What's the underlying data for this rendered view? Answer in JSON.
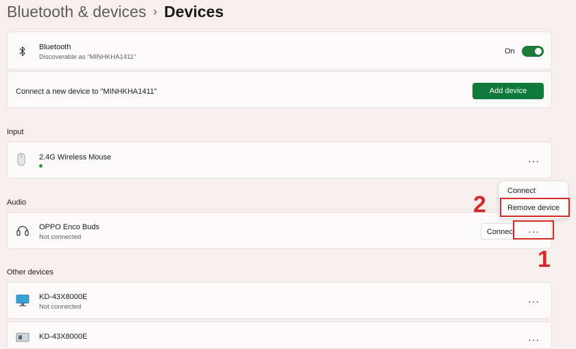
{
  "breadcrumb": {
    "parent": "Bluetooth & devices",
    "separator": "›",
    "current": "Devices"
  },
  "bluetooth": {
    "title": "Bluetooth",
    "subtitle": "Discoverable as \"MINHKHA1411\"",
    "toggle_label": "On",
    "toggle_on": true
  },
  "pair": {
    "text": "Connect a new device to \"MINHKHA1411\"",
    "button": "Add device"
  },
  "sections": {
    "input": "Input",
    "audio": "Audio",
    "other": "Other devices"
  },
  "devices": {
    "mouse": {
      "name": "2.4G Wireless Mouse"
    },
    "buds": {
      "name": "OPPO Enco Buds",
      "status": "Not connected",
      "connect": "Connect"
    },
    "tv1": {
      "name": "KD-43X8000E",
      "status": "Not connected"
    },
    "tv2": {
      "name": "KD-43X8000E"
    }
  },
  "more_label": "···",
  "context_menu": {
    "items": [
      "Connect",
      "Remove device"
    ]
  },
  "annotations": {
    "step1": "1",
    "step2": "2"
  },
  "colors": {
    "accent": "#0f7a3a",
    "annotation": "#d42a2a",
    "status_dot": "#1e9b45"
  }
}
